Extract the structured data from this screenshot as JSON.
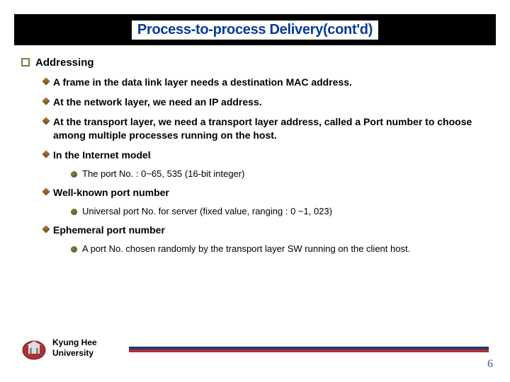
{
  "title": "Process-to-process Delivery(cont'd)",
  "sectionHeading": "Addressing",
  "points": {
    "p1": "A frame in the data link layer needs a destination MAC address.",
    "p2": "At the network layer, we need an IP address.",
    "p3": "At the transport layer, we need a transport layer address, called a Port number to choose among multiple processes running on the host.",
    "p4": "In the Internet model",
    "p4_1": "The port No.  :  0~65, 535  (16-bit integer)",
    "p5": "Well-known port number",
    "p5_1": "Universal port No. for server  (fixed value, ranging : 0 ~1, 023)",
    "p6": "Ephemeral port number",
    "p6_1": "A port No. chosen randomly by the transport layer SW running on the client host."
  },
  "footer": {
    "university_line1": "Kyung Hee",
    "university_line2": "University",
    "pageNumber": "6"
  }
}
